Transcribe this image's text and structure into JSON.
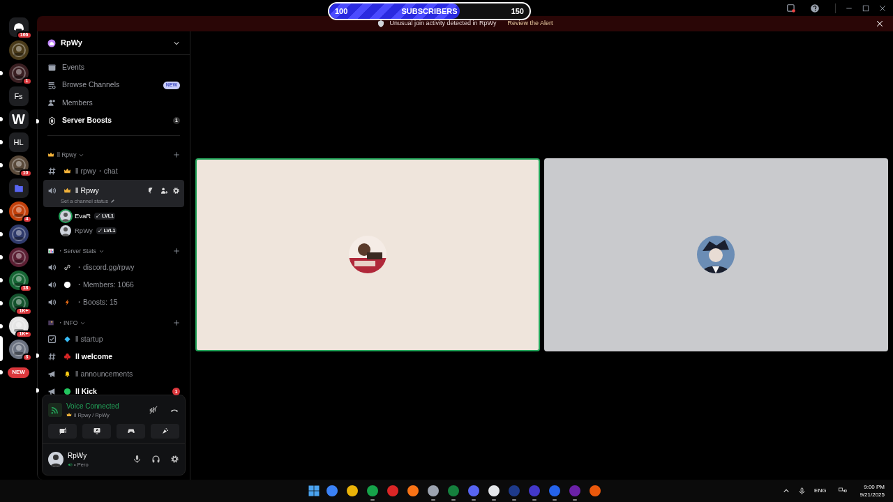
{
  "subscriber_goal": {
    "start": "100",
    "label": "SUBSCRIBERS",
    "end": "150",
    "level": 0.65
  },
  "alert": {
    "text": "Unusual join activity detected in RpWy",
    "link": "Review the Alert"
  },
  "server_rail": [
    {
      "kind": "home",
      "badge": "166",
      "unread": false,
      "selected": false
    },
    {
      "kind": "picture",
      "unread": false,
      "selected": false,
      "color": "#4a3b1a"
    },
    {
      "kind": "picture",
      "badge": "1",
      "unread": true,
      "selected": false,
      "color": "#3a1f22"
    },
    {
      "kind": "text",
      "text": "Fs",
      "unread": false,
      "selected": false
    },
    {
      "kind": "text",
      "text": "W",
      "unread": true,
      "selected": false
    },
    {
      "kind": "text",
      "text": "HL",
      "unread": true,
      "selected": false
    },
    {
      "kind": "picture",
      "badge": "10",
      "unread": true,
      "selected": false,
      "color": "#5a4a3a"
    },
    {
      "kind": "folder",
      "unread": false,
      "selected": false
    },
    {
      "kind": "picture",
      "badge": "4",
      "unread": true,
      "selected": false,
      "color": "#c2410c"
    },
    {
      "kind": "picture",
      "unread": true,
      "selected": false,
      "color": "#2f3a6b"
    },
    {
      "kind": "picture",
      "unread": true,
      "selected": false,
      "color": "#5b1f33"
    },
    {
      "kind": "picture",
      "badge": "18",
      "unread": true,
      "selected": false,
      "color": "#166534"
    },
    {
      "kind": "picture",
      "badge": "1K+",
      "unread": true,
      "selected": false,
      "color": "#14532d"
    },
    {
      "kind": "picture",
      "badge": "1K+",
      "unread": true,
      "selected": false,
      "color": "#e5e5e5"
    },
    {
      "kind": "picture",
      "badge": "3",
      "unread": false,
      "selected": true,
      "color": "#6b7280"
    },
    {
      "kind": "new",
      "text": "NEW",
      "unread": true,
      "selected": false
    }
  ],
  "server": {
    "name": "RpWy"
  },
  "nav": [
    {
      "kind": "events",
      "label": "Events",
      "unread": false
    },
    {
      "kind": "browse",
      "label": "Browse Channels",
      "tag": "NEW",
      "unread": false
    },
    {
      "kind": "members",
      "label": "Members",
      "unread": false
    },
    {
      "kind": "boosts",
      "label": "Server Boosts",
      "count": "1",
      "unread": true
    }
  ],
  "categories": [
    {
      "emoji": {
        "kind": "crown"
      },
      "name": "ll Rpwy",
      "channels": [
        {
          "kind": "text",
          "emoji": {
            "kind": "crown"
          },
          "name": "ll rpwy・chat",
          "unread": false,
          "selected": false
        },
        {
          "kind": "voice",
          "emoji": {
            "kind": "crown"
          },
          "name": "ll Rpwy",
          "unread": false,
          "selected": true,
          "status": "Set a channel status",
          "members": [
            {
              "name": "EvaR",
              "tag": "LVL1",
              "speaking": true
            },
            {
              "name": "RpWy",
              "tag": "LVL1",
              "speaking": false
            }
          ]
        }
      ]
    },
    {
      "emoji": {
        "kind": "chart"
      },
      "name": "・Server Stats",
      "channels": [
        {
          "kind": "voice",
          "emoji": {
            "kind": "link"
          },
          "name": "・discord.gg/rpwy",
          "unread": false,
          "selected": false
        },
        {
          "kind": "voice",
          "emoji": {
            "kind": "circle"
          },
          "name": "・Members: 1066",
          "unread": false,
          "selected": false
        },
        {
          "kind": "voice",
          "emoji": {
            "kind": "bolt"
          },
          "name": "・Boosts: 15",
          "unread": false,
          "selected": false
        }
      ]
    },
    {
      "emoji": {
        "kind": "picture"
      },
      "name": "・INFO",
      "channels": [
        {
          "kind": "rules",
          "emoji": {
            "kind": "diamond"
          },
          "name": "ll startup",
          "unread": false,
          "selected": false
        },
        {
          "kind": "text",
          "emoji": {
            "kind": "club"
          },
          "name": "ll welcome",
          "unread": true,
          "selected": false
        },
        {
          "kind": "announce",
          "emoji": {
            "kind": "bell"
          },
          "name": "ll announcements",
          "unread": false,
          "selected": false
        },
        {
          "kind": "announce",
          "emoji": {
            "kind": "greendot"
          },
          "name": "ll Kick",
          "unread": true,
          "selected": false,
          "badge": "1"
        }
      ]
    }
  ],
  "voice_panel": {
    "status": "Voice Connected",
    "channel": "ll Rpwy / RpWy"
  },
  "user": {
    "name": "RpWy",
    "status": "• Pero"
  },
  "stage": [
    {
      "speaking": true,
      "color": "#efe5dc"
    },
    {
      "speaking": false,
      "color": "#c9cacd"
    }
  ],
  "taskbar": {
    "apps": [
      {
        "color": "#3b82f6",
        "running": false
      },
      {
        "color": "#eab308",
        "running": false
      },
      {
        "color": "#16a34a",
        "running": true
      },
      {
        "color": "#dc2626",
        "running": false
      },
      {
        "color": "#f97316",
        "running": false
      },
      {
        "color": "#9ca3af",
        "running": true
      },
      {
        "color": "#15803d",
        "running": true
      },
      {
        "color": "#5865f2",
        "running": true
      },
      {
        "color": "#e5e7eb",
        "running": true
      },
      {
        "color": "#1e3a8a",
        "running": true
      },
      {
        "color": "#4338ca",
        "running": true
      },
      {
        "color": "#2563eb",
        "running": true
      },
      {
        "color": "#6b21a8",
        "running": true
      },
      {
        "color": "#ea580c",
        "running": false
      }
    ],
    "language": "ENG",
    "time": "9:00 PM",
    "date": "9/21/2025"
  }
}
